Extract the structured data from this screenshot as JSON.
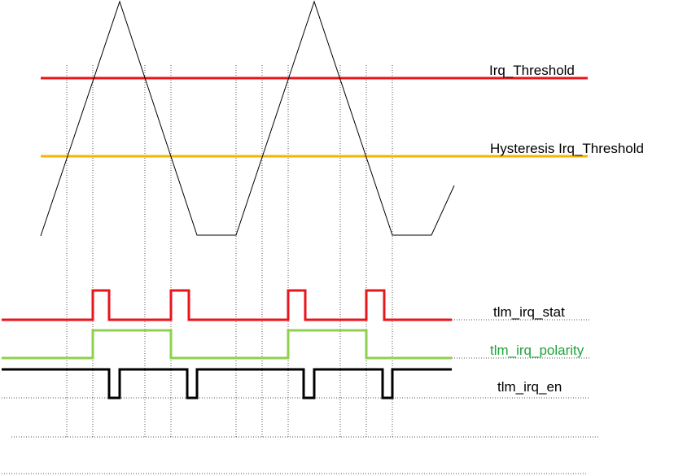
{
  "labels": {
    "irq_threshold": "Irq_Threshold",
    "hysteresis_threshold": "Hysteresis Irq_Threshold",
    "irq_stat": "tlm_irq_stat",
    "irq_polarity": "tlm_irq_polarity",
    "irq_en": "tlm_irq_en"
  },
  "colors": {
    "irq_threshold": "#e8161b",
    "hysteresis_threshold": "#f5b400",
    "irq_stat": "#e8161b",
    "irq_polarity": "#8fd14f",
    "irq_polarity_text": "#1fa33a",
    "irq_en": "#000000",
    "triangle": "#000000",
    "guides": "#555555"
  }
}
